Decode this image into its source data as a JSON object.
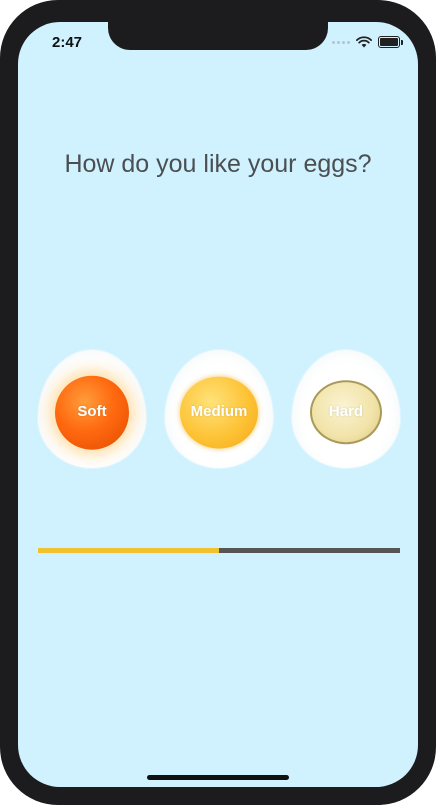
{
  "status_bar": {
    "time": "2:47",
    "icons": [
      "signal-icon",
      "wifi-icon",
      "battery-icon"
    ]
  },
  "title": "How do you like your eggs?",
  "eggs": [
    {
      "label": "Soft",
      "icon": "soft-egg-icon",
      "yolk_color": "#ff6a10"
    },
    {
      "label": "Medium",
      "icon": "medium-egg-icon",
      "yolk_color": "#fdc336"
    },
    {
      "label": "Hard",
      "icon": "hard-egg-icon",
      "yolk_color": "#f1e3a8"
    }
  ],
  "progress": {
    "fraction": 0.5,
    "fill_color": "#f2c12e",
    "track_color": "#555555"
  },
  "colors": {
    "background": "#cff2fe",
    "title_text": "#4b4f52"
  }
}
